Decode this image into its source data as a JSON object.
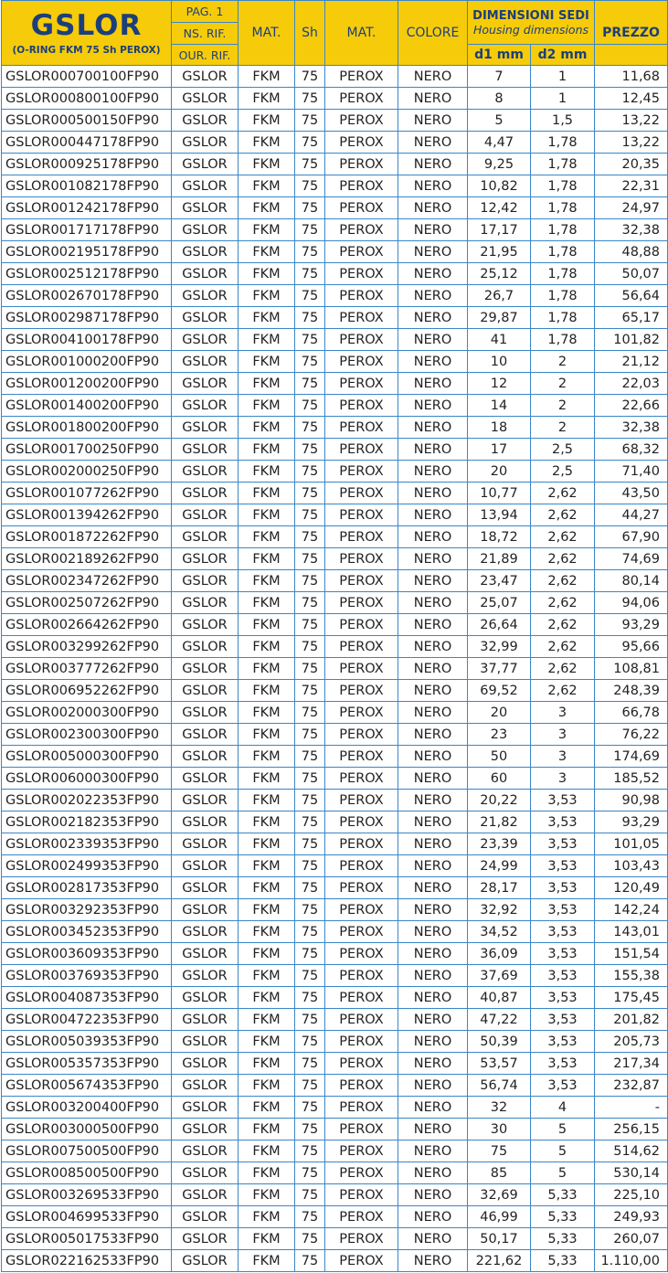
{
  "header": {
    "brand": "GSLOR",
    "brand_sub": "(O-RING FKM 75 Sh PEROX)",
    "pag": "PAG. 1",
    "ns_rif": "NS. RIF.",
    "our_rif": "OUR. RIF.",
    "mat1": "MAT.",
    "sh": "Sh",
    "mat2": "MAT.",
    "colore": "COLORE",
    "dim_title": "DIMENSIONI SEDI",
    "dim_sub": "Housing dimensions",
    "d1": "d1 mm",
    "d2": "d2 mm",
    "prezzo": "PREZZO"
  },
  "colors": {
    "header_bg": "#f6cb0a",
    "header_text": "#1c3f7a",
    "border": "#3a86c8"
  },
  "rows": [
    [
      "GSLOR000700100FP90",
      "GSLOR",
      "FKM",
      "75",
      "PEROX",
      "NERO",
      "7",
      "1",
      "11,68"
    ],
    [
      "GSLOR000800100FP90",
      "GSLOR",
      "FKM",
      "75",
      "PEROX",
      "NERO",
      "8",
      "1",
      "12,45"
    ],
    [
      "GSLOR000500150FP90",
      "GSLOR",
      "FKM",
      "75",
      "PEROX",
      "NERO",
      "5",
      "1,5",
      "13,22"
    ],
    [
      "GSLOR000447178FP90",
      "GSLOR",
      "FKM",
      "75",
      "PEROX",
      "NERO",
      "4,47",
      "1,78",
      "13,22"
    ],
    [
      "GSLOR000925178FP90",
      "GSLOR",
      "FKM",
      "75",
      "PEROX",
      "NERO",
      "9,25",
      "1,78",
      "20,35"
    ],
    [
      "GSLOR001082178FP90",
      "GSLOR",
      "FKM",
      "75",
      "PEROX",
      "NERO",
      "10,82",
      "1,78",
      "22,31"
    ],
    [
      "GSLOR001242178FP90",
      "GSLOR",
      "FKM",
      "75",
      "PEROX",
      "NERO",
      "12,42",
      "1,78",
      "24,97"
    ],
    [
      "GSLOR001717178FP90",
      "GSLOR",
      "FKM",
      "75",
      "PEROX",
      "NERO",
      "17,17",
      "1,78",
      "32,38"
    ],
    [
      "GSLOR002195178FP90",
      "GSLOR",
      "FKM",
      "75",
      "PEROX",
      "NERO",
      "21,95",
      "1,78",
      "48,88"
    ],
    [
      "GSLOR002512178FP90",
      "GSLOR",
      "FKM",
      "75",
      "PEROX",
      "NERO",
      "25,12",
      "1,78",
      "50,07"
    ],
    [
      "GSLOR002670178FP90",
      "GSLOR",
      "FKM",
      "75",
      "PEROX",
      "NERO",
      "26,7",
      "1,78",
      "56,64"
    ],
    [
      "GSLOR002987178FP90",
      "GSLOR",
      "FKM",
      "75",
      "PEROX",
      "NERO",
      "29,87",
      "1,78",
      "65,17"
    ],
    [
      "GSLOR004100178FP90",
      "GSLOR",
      "FKM",
      "75",
      "PEROX",
      "NERO",
      "41",
      "1,78",
      "101,82"
    ],
    [
      "GSLOR001000200FP90",
      "GSLOR",
      "FKM",
      "75",
      "PEROX",
      "NERO",
      "10",
      "2",
      "21,12"
    ],
    [
      "GSLOR001200200FP90",
      "GSLOR",
      "FKM",
      "75",
      "PEROX",
      "NERO",
      "12",
      "2",
      "22,03"
    ],
    [
      "GSLOR001400200FP90",
      "GSLOR",
      "FKM",
      "75",
      "PEROX",
      "NERO",
      "14",
      "2",
      "22,66"
    ],
    [
      "GSLOR001800200FP90",
      "GSLOR",
      "FKM",
      "75",
      "PEROX",
      "NERO",
      "18",
      "2",
      "32,38"
    ],
    [
      "GSLOR001700250FP90",
      "GSLOR",
      "FKM",
      "75",
      "PEROX",
      "NERO",
      "17",
      "2,5",
      "68,32"
    ],
    [
      "GSLOR002000250FP90",
      "GSLOR",
      "FKM",
      "75",
      "PEROX",
      "NERO",
      "20",
      "2,5",
      "71,40"
    ],
    [
      "GSLOR001077262FP90",
      "GSLOR",
      "FKM",
      "75",
      "PEROX",
      "NERO",
      "10,77",
      "2,62",
      "43,50"
    ],
    [
      "GSLOR001394262FP90",
      "GSLOR",
      "FKM",
      "75",
      "PEROX",
      "NERO",
      "13,94",
      "2,62",
      "44,27"
    ],
    [
      "GSLOR001872262FP90",
      "GSLOR",
      "FKM",
      "75",
      "PEROX",
      "NERO",
      "18,72",
      "2,62",
      "67,90"
    ],
    [
      "GSLOR002189262FP90",
      "GSLOR",
      "FKM",
      "75",
      "PEROX",
      "NERO",
      "21,89",
      "2,62",
      "74,69"
    ],
    [
      "GSLOR002347262FP90",
      "GSLOR",
      "FKM",
      "75",
      "PEROX",
      "NERO",
      "23,47",
      "2,62",
      "80,14"
    ],
    [
      "GSLOR002507262FP90",
      "GSLOR",
      "FKM",
      "75",
      "PEROX",
      "NERO",
      "25,07",
      "2,62",
      "94,06"
    ],
    [
      "GSLOR002664262FP90",
      "GSLOR",
      "FKM",
      "75",
      "PEROX",
      "NERO",
      "26,64",
      "2,62",
      "93,29"
    ],
    [
      "GSLOR003299262FP90",
      "GSLOR",
      "FKM",
      "75",
      "PEROX",
      "NERO",
      "32,99",
      "2,62",
      "95,66"
    ],
    [
      "GSLOR003777262FP90",
      "GSLOR",
      "FKM",
      "75",
      "PEROX",
      "NERO",
      "37,77",
      "2,62",
      "108,81"
    ],
    [
      "GSLOR006952262FP90",
      "GSLOR",
      "FKM",
      "75",
      "PEROX",
      "NERO",
      "69,52",
      "2,62",
      "248,39"
    ],
    [
      "GSLOR002000300FP90",
      "GSLOR",
      "FKM",
      "75",
      "PEROX",
      "NERO",
      "20",
      "3",
      "66,78"
    ],
    [
      "GSLOR002300300FP90",
      "GSLOR",
      "FKM",
      "75",
      "PEROX",
      "NERO",
      "23",
      "3",
      "76,22"
    ],
    [
      "GSLOR005000300FP90",
      "GSLOR",
      "FKM",
      "75",
      "PEROX",
      "NERO",
      "50",
      "3",
      "174,69"
    ],
    [
      "GSLOR006000300FP90",
      "GSLOR",
      "FKM",
      "75",
      "PEROX",
      "NERO",
      "60",
      "3",
      "185,52"
    ],
    [
      "GSLOR002022353FP90",
      "GSLOR",
      "FKM",
      "75",
      "PEROX",
      "NERO",
      "20,22",
      "3,53",
      "90,98"
    ],
    [
      "GSLOR002182353FP90",
      "GSLOR",
      "FKM",
      "75",
      "PEROX",
      "NERO",
      "21,82",
      "3,53",
      "93,29"
    ],
    [
      "GSLOR002339353FP90",
      "GSLOR",
      "FKM",
      "75",
      "PEROX",
      "NERO",
      "23,39",
      "3,53",
      "101,05"
    ],
    [
      "GSLOR002499353FP90",
      "GSLOR",
      "FKM",
      "75",
      "PEROX",
      "NERO",
      "24,99",
      "3,53",
      "103,43"
    ],
    [
      "GSLOR002817353FP90",
      "GSLOR",
      "FKM",
      "75",
      "PEROX",
      "NERO",
      "28,17",
      "3,53",
      "120,49"
    ],
    [
      "GSLOR003292353FP90",
      "GSLOR",
      "FKM",
      "75",
      "PEROX",
      "NERO",
      "32,92",
      "3,53",
      "142,24"
    ],
    [
      "GSLOR003452353FP90",
      "GSLOR",
      "FKM",
      "75",
      "PEROX",
      "NERO",
      "34,52",
      "3,53",
      "143,01"
    ],
    [
      "GSLOR003609353FP90",
      "GSLOR",
      "FKM",
      "75",
      "PEROX",
      "NERO",
      "36,09",
      "3,53",
      "151,54"
    ],
    [
      "GSLOR003769353FP90",
      "GSLOR",
      "FKM",
      "75",
      "PEROX",
      "NERO",
      "37,69",
      "3,53",
      "155,38"
    ],
    [
      "GSLOR004087353FP90",
      "GSLOR",
      "FKM",
      "75",
      "PEROX",
      "NERO",
      "40,87",
      "3,53",
      "175,45"
    ],
    [
      "GSLOR004722353FP90",
      "GSLOR",
      "FKM",
      "75",
      "PEROX",
      "NERO",
      "47,22",
      "3,53",
      "201,82"
    ],
    [
      "GSLOR005039353FP90",
      "GSLOR",
      "FKM",
      "75",
      "PEROX",
      "NERO",
      "50,39",
      "3,53",
      "205,73"
    ],
    [
      "GSLOR005357353FP90",
      "GSLOR",
      "FKM",
      "75",
      "PEROX",
      "NERO",
      "53,57",
      "3,53",
      "217,34"
    ],
    [
      "GSLOR005674353FP90",
      "GSLOR",
      "FKM",
      "75",
      "PEROX",
      "NERO",
      "56,74",
      "3,53",
      "232,87"
    ],
    [
      "GSLOR003200400FP90",
      "GSLOR",
      "FKM",
      "75",
      "PEROX",
      "NERO",
      "32",
      "4",
      "-"
    ],
    [
      "GSLOR003000500FP90",
      "GSLOR",
      "FKM",
      "75",
      "PEROX",
      "NERO",
      "30",
      "5",
      "256,15"
    ],
    [
      "GSLOR007500500FP90",
      "GSLOR",
      "FKM",
      "75",
      "PEROX",
      "NERO",
      "75",
      "5",
      "514,62"
    ],
    [
      "GSLOR008500500FP90",
      "GSLOR",
      "FKM",
      "75",
      "PEROX",
      "NERO",
      "85",
      "5",
      "530,14"
    ],
    [
      "GSLOR003269533FP90",
      "GSLOR",
      "FKM",
      "75",
      "PEROX",
      "NERO",
      "32,69",
      "5,33",
      "225,10"
    ],
    [
      "GSLOR004699533FP90",
      "GSLOR",
      "FKM",
      "75",
      "PEROX",
      "NERO",
      "46,99",
      "5,33",
      "249,93"
    ],
    [
      "GSLOR005017533FP90",
      "GSLOR",
      "FKM",
      "75",
      "PEROX",
      "NERO",
      "50,17",
      "5,33",
      "260,07"
    ],
    [
      "GSLOR022162533FP90",
      "GSLOR",
      "FKM",
      "75",
      "PEROX",
      "NERO",
      "221,62",
      "5,33",
      "1.110,00"
    ]
  ]
}
